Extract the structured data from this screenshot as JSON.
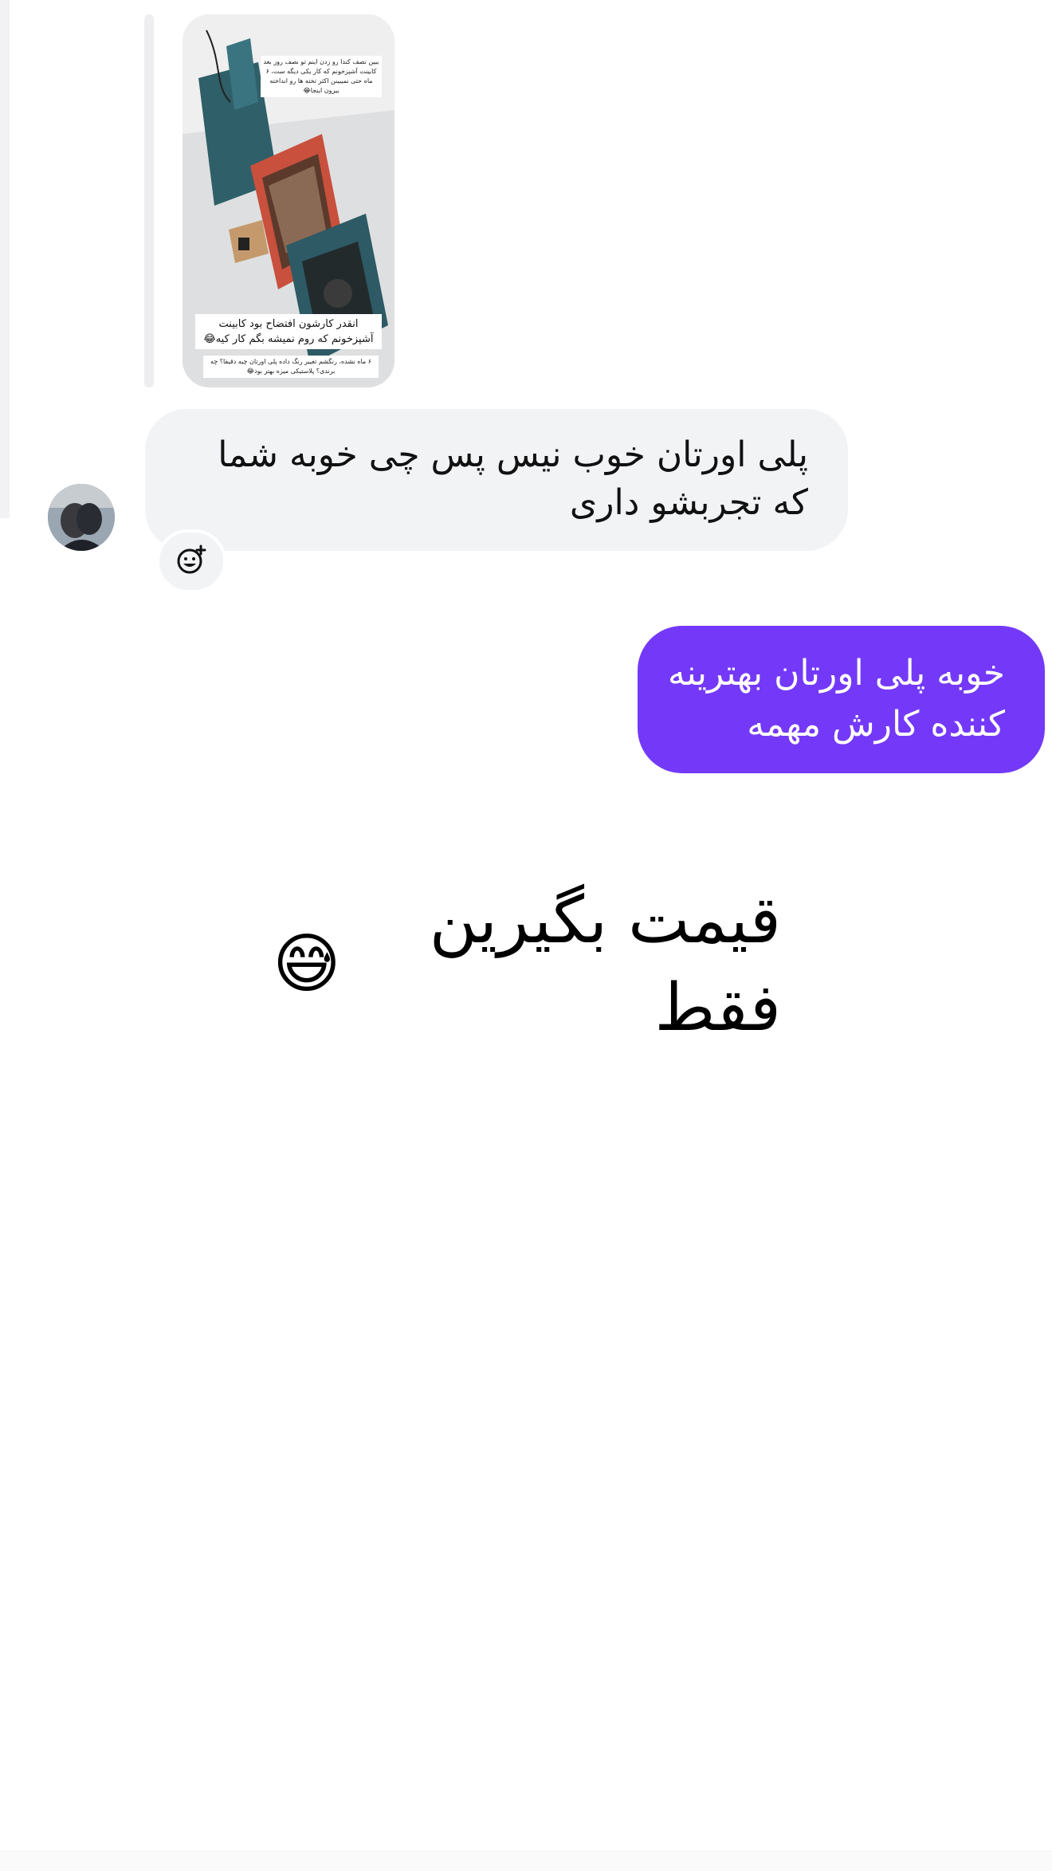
{
  "story_reply": {
    "top_caption": "ببین نصف کندا رو زدن اینم تو نصف روز بعد کابینت آشپزخونم که کار یکی دیگه ست، ۶ ماه حتی نمیبینن اکثر تخته ها رو انداخته بیرون اینجا😂",
    "middle_caption": "انقدر کارشون افتضاح بود کابینت آشپزخونم که روم نمیشه بگم کار کیه😂",
    "bottom_caption": "۶ ماه نشده، رنگشم تغییر رنگ داده پلی اورتان چیه دقیقا؟ چه برندی؟ پلاستیکی میزه بهتر بود😂"
  },
  "incoming_message": {
    "text": "پلی اورتان خوب نیس پس چی خوبه شما که تجربشو داری"
  },
  "outgoing_message": {
    "text": "خوبه پلی اورتان بهترینه کننده کارش مهمه"
  },
  "overlay_caption": {
    "text": "قیمت بگیرین فقط",
    "emoji": "😅"
  },
  "colors": {
    "outgoing_bubble": "#7439f8",
    "incoming_bubble": "#f2f3f5"
  },
  "icons": {
    "reaction": "add-reaction-icon",
    "avatar": "user-avatar"
  }
}
